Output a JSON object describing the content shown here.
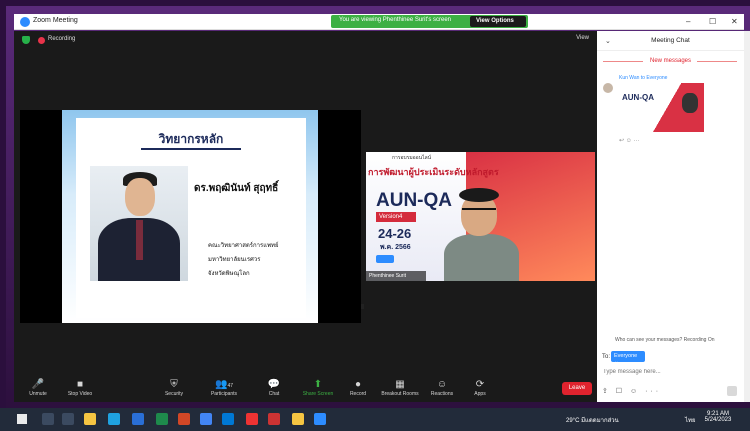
{
  "window": {
    "title": "Zoom Meeting"
  },
  "banner": {
    "text": "You are viewing Phenthinee Surit's screen",
    "view_options": "View Options"
  },
  "window_controls": {
    "minimize": "–",
    "maximize": "☐",
    "close": "✕"
  },
  "stage": {
    "recording": "Recording",
    "view": "View"
  },
  "slide": {
    "heading": "วิทยากรหลัก",
    "name": "ดร.พฤฒินันท์ สุฤทธิ์",
    "affiliation": [
      "คณะวิทยาศาสตร์การแพทย์",
      "มหาวิทยาลัยนเรศวร",
      "จังหวัดพิษณุโลก"
    ]
  },
  "camera": {
    "pre_title": "การอบรมออนไลน์",
    "course_title": "การพัฒนาผู้ประเมินระดับหลักสูตร",
    "aun": "AUN-QA",
    "version": "Version4",
    "dates": "24-26",
    "month": "พ.ค. 2566",
    "participant_name": "Phenthinee Surit"
  },
  "toolbar": {
    "items": [
      {
        "label": "Unmute",
        "icon": "🎤"
      },
      {
        "label": "Stop Video",
        "icon": "■"
      },
      {
        "label": "Security",
        "icon": "⛨"
      },
      {
        "label": "Participants",
        "icon": "👥",
        "count": "47"
      },
      {
        "label": "Chat",
        "icon": "💬"
      },
      {
        "label": "Share Screen",
        "icon": "⬆"
      },
      {
        "label": "Record",
        "icon": "●"
      },
      {
        "label": "Breakout Rooms",
        "icon": "▦"
      },
      {
        "label": "Reactions",
        "icon": "☺"
      },
      {
        "label": "Apps",
        "icon": "⟳"
      }
    ],
    "leave": "Leave"
  },
  "chat": {
    "title": "Meeting Chat",
    "new_messages": "New messages",
    "message_from": "Kun Wan to Everyone",
    "image_title": "AUN-QA",
    "who_can_see": "Who can see your messages? Recording On",
    "to_label": "To:",
    "to_value": "Everyone ⌄",
    "placeholder": "Type message here..."
  },
  "taskbar": {
    "weather": "29°C  มีแดดมากส่วน",
    "time": "9:21 AM",
    "date": "5/24/2023",
    "lang": "ไทย"
  },
  "colors": {
    "zoom_blue": "#2d8cff",
    "share_green": "#3cb043",
    "leave_red": "#e0232e"
  }
}
